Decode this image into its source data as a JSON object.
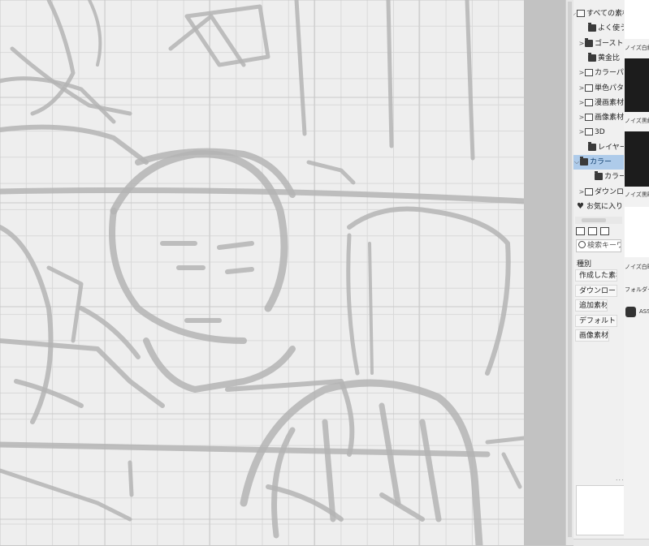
{
  "material_tree": {
    "items": [
      {
        "label": "すべての素材",
        "arrow": "⌵",
        "icon": "grid-icon"
      },
      {
        "label": "よく使う素材",
        "arrow": "",
        "icon": "folder-icon"
      },
      {
        "label": "ゴースト",
        "arrow": ">",
        "icon": "folder-icon"
      },
      {
        "label": "黄金比",
        "arrow": "",
        "icon": "folder-icon"
      },
      {
        "label": "カラーパターン",
        "arrow": ">",
        "icon": "color-pattern-icon"
      },
      {
        "label": "単色パターン",
        "arrow": ">",
        "icon": "mono-pattern-icon"
      },
      {
        "label": "漫画素材",
        "arrow": ">",
        "icon": "manga-icon"
      },
      {
        "label": "画像素材",
        "arrow": ">",
        "icon": "image-icon"
      },
      {
        "label": "3D",
        "arrow": ">",
        "icon": "3d-icon"
      },
      {
        "label": "レイヤーテンプレート",
        "arrow": "",
        "icon": "folder-icon"
      },
      {
        "label": "カラー",
        "arrow": "⌵",
        "icon": "open-folder-icon",
        "selected": true
      },
      {
        "label": "カラー",
        "arrow": "",
        "icon": "folder-icon"
      },
      {
        "label": "ダウンロード",
        "arrow": ">",
        "icon": "download-icon"
      },
      {
        "label": "お気に入り",
        "arrow": "",
        "icon": "heart-icon"
      }
    ]
  },
  "search": {
    "placeholder": "検索キーワード"
  },
  "kind": {
    "label": "種別",
    "tags": [
      "作成した素材",
      "ダウンロード",
      "追加素材",
      "デフォルトタグ",
      "画像素材"
    ]
  },
  "material_list": {
    "items": [
      {
        "label": "ノイズ白線",
        "style": "white"
      },
      {
        "label": "ノイズ黒線",
        "style": "dark"
      },
      {
        "label": "ノイズ黒暗",
        "style": "dark"
      },
      {
        "label": "ノイズ白暗",
        "style": "white"
      }
    ],
    "folder_label": "フォルダー内",
    "assets_label": "ASSETS"
  }
}
